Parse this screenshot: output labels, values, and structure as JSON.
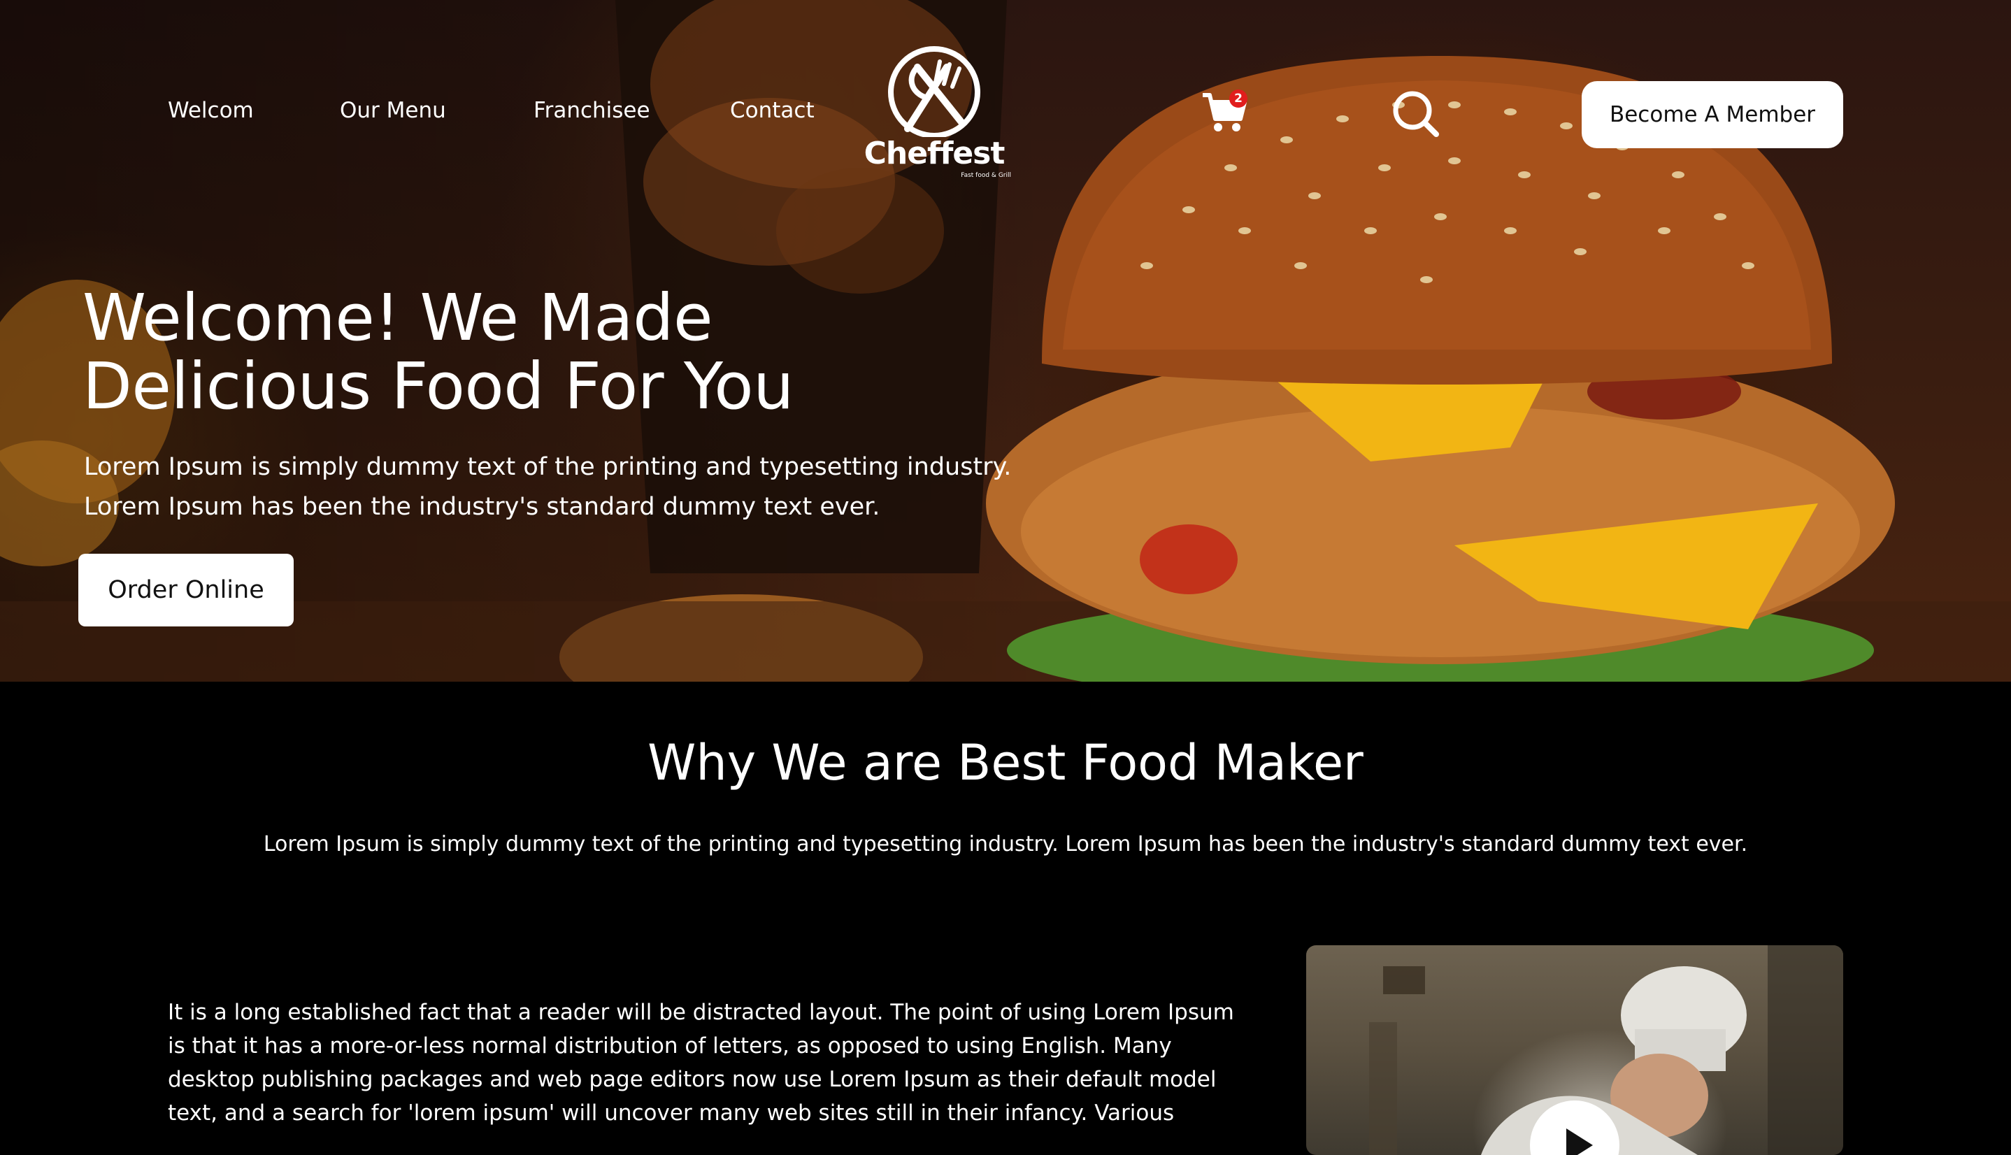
{
  "nav": {
    "links": [
      "Welcom",
      "Our Menu",
      "Franchisee",
      "Contact"
    ],
    "cart_count": "2",
    "member_label": "Become A Member"
  },
  "logo": {
    "name": "Cheffest",
    "tagline": "Fast food & Grill"
  },
  "hero": {
    "title_lines": [
      "Welcome! We Made",
      "Delicious Food For You"
    ],
    "desc_lines": [
      "Lorem Ipsum is simply dummy text of the printing and typesetting industry.",
      "Lorem Ipsum has been the industry's standard dummy text ever."
    ],
    "order_label": "Order Online"
  },
  "why": {
    "title": "Why We are Best Food Maker",
    "subtitle": "Lorem Ipsum is simply dummy text of the printing and typesetting industry. Lorem Ipsum has been the industry's standard dummy text ever.",
    "body_lines": [
      "It is a long established fact that a reader will be distracted layout. The point of using Lorem Ipsum",
      "is that it has a more-or-less normal distribution of letters, as opposed to using English. Many",
      "desktop publishing packages and web page editors now use Lorem Ipsum as their default model",
      "text, and a search for 'lorem ipsum' will uncover many web sites still in their infancy. Various"
    ]
  },
  "colors": {
    "badge": "#e11d1d",
    "button_bg": "#ffffff",
    "page_bg": "#000000"
  },
  "icons": [
    "logo-icon",
    "cart-icon",
    "search-icon",
    "play-icon"
  ]
}
